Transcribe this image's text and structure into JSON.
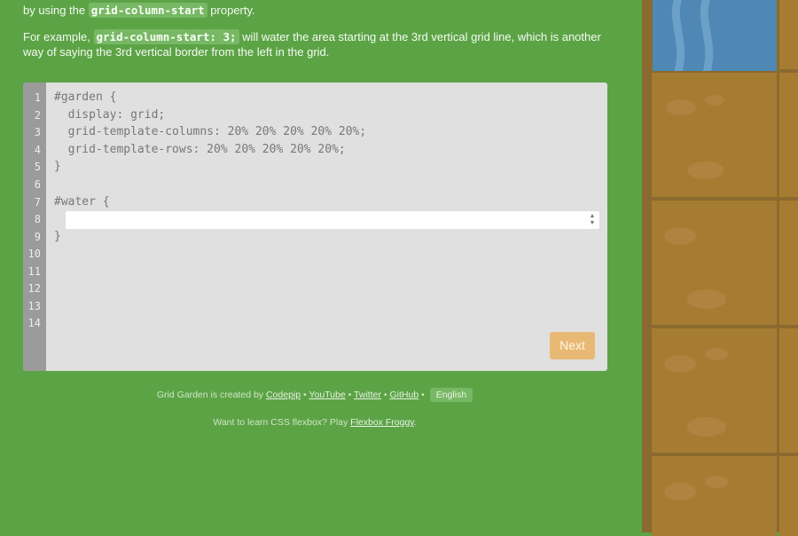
{
  "instructions": {
    "p1_prefix": "by using the",
    "p1_code": "grid-column-start",
    "p1_suffix": "property.",
    "p2_prefix": "For example,",
    "p2_code": "grid-column-start: 3;",
    "p2_suffix": "will water the area starting at the 3rd vertical grid line, which is another way of saying the 3rd vertical border from the left in the grid."
  },
  "editor": {
    "line_numbers": [
      "1",
      "2",
      "3",
      "4",
      "5",
      "6",
      "7",
      "8",
      "9",
      "10",
      "11",
      "12",
      "13",
      "14"
    ],
    "code_lines": {
      "l1": "#garden {",
      "l2": "  display: grid;",
      "l3": "  grid-template-columns: 20% 20% 20% 20% 20%;",
      "l4": "  grid-template-rows: 20% 20% 20% 20% 20%;",
      "l5": "}",
      "l7": "#water {",
      "l9": "}"
    },
    "answer_value": "",
    "next_label": "Next"
  },
  "footer": {
    "credits_prefix": "Grid Garden is created by",
    "links": [
      "Codepip",
      "YouTube",
      "Twitter",
      "GitHub"
    ],
    "separator": "•",
    "language": "English",
    "froggy_prefix": "Want to learn CSS flexbox? Play",
    "froggy_link": "Flexbox Froggy",
    "froggy_suffix": "."
  },
  "colors": {
    "background": "#5ca346",
    "soil": "#a67c33",
    "water": "#4f88b4",
    "next_button": "#e8b974"
  }
}
